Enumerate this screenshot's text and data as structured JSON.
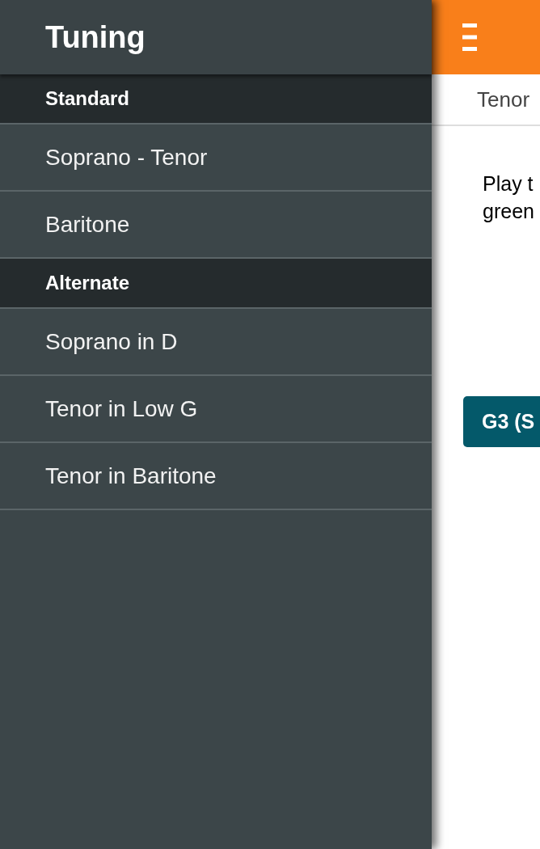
{
  "drawer": {
    "title": "Tuning",
    "sections": [
      {
        "heading": "Standard",
        "items": [
          {
            "label": "Soprano - Tenor"
          },
          {
            "label": "Baritone"
          }
        ]
      },
      {
        "heading": "Alternate",
        "items": [
          {
            "label": "Soprano in D"
          },
          {
            "label": "Tenor in Low G"
          },
          {
            "label": "Tenor in Baritone"
          }
        ]
      }
    ]
  },
  "main": {
    "tab_label": "Tenor",
    "instruction_lines": [
      "Play t",
      "green"
    ],
    "note_button": "G3 (S"
  }
}
